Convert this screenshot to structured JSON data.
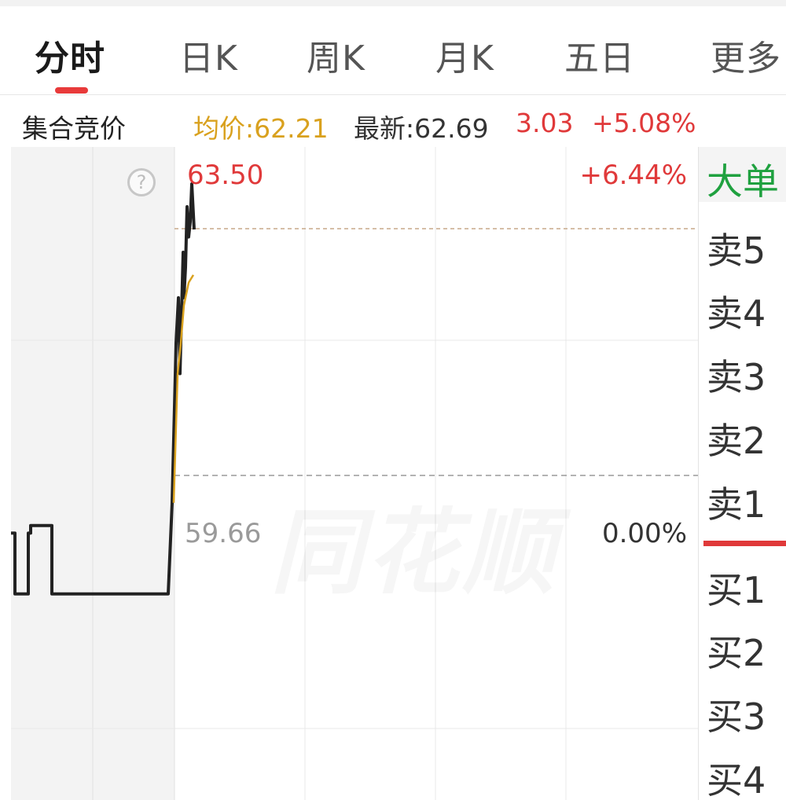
{
  "tabs": [
    {
      "label": "分时",
      "active": true
    },
    {
      "label": "日K",
      "active": false
    },
    {
      "label": "周K",
      "active": false
    },
    {
      "label": "月K",
      "active": false
    },
    {
      "label": "五日",
      "active": false
    },
    {
      "label": "更多",
      "active": false
    }
  ],
  "info": {
    "title": "集合竞价",
    "avg": "均价:62.21",
    "latest": "最新:62.69",
    "change": "3.03",
    "change_pct": "+5.08%"
  },
  "chart": {
    "help_icon": "help-circle-icon",
    "high_price": "63.50",
    "high_pct": "+6.44%",
    "base_price": "59.66",
    "base_pct": "0.00%",
    "watermark": "同花顺"
  },
  "chart_data": {
    "type": "line",
    "y_range": [
      55.82,
      63.5
    ],
    "reference_price": 59.66,
    "series": [
      {
        "color": "#222222",
        "points": [
          [
            0,
            58.9
          ],
          [
            5,
            58.9
          ],
          [
            5,
            58.1
          ],
          [
            22,
            58.1
          ],
          [
            22,
            58.9
          ],
          [
            25,
            58.9
          ],
          [
            25,
            59.0
          ],
          [
            52,
            59.0
          ],
          [
            52,
            58.1
          ],
          [
            70,
            58.1
          ],
          [
            200,
            58.1
          ],
          [
            205,
            59.3
          ],
          [
            210,
            61.4
          ],
          [
            213,
            62.0
          ],
          [
            215,
            61.0
          ],
          [
            217,
            61.8
          ],
          [
            219,
            62.6
          ],
          [
            220,
            62.0
          ],
          [
            222,
            62.4
          ],
          [
            224,
            63.2
          ],
          [
            226,
            62.8
          ],
          [
            228,
            63.0
          ],
          [
            230,
            63.5
          ],
          [
            233,
            62.9
          ]
        ]
      },
      {
        "color": "#d9a11e",
        "points": [
          [
            207,
            59.3
          ],
          [
            212,
            61.0
          ],
          [
            216,
            61.4
          ],
          [
            220,
            61.9
          ],
          [
            226,
            62.2
          ],
          [
            232,
            62.3
          ]
        ]
      }
    ],
    "reference_line_color": "#c7a98a"
  },
  "book": {
    "header": "大单",
    "sells": [
      "卖5",
      "卖4",
      "卖3",
      "卖2",
      "卖1"
    ],
    "buys": [
      "买1",
      "买2",
      "买3",
      "买4"
    ]
  },
  "colors": {
    "red": "#e0393a",
    "gold": "#d9a11e",
    "green": "#1fa13f",
    "price_line": "#222222"
  }
}
